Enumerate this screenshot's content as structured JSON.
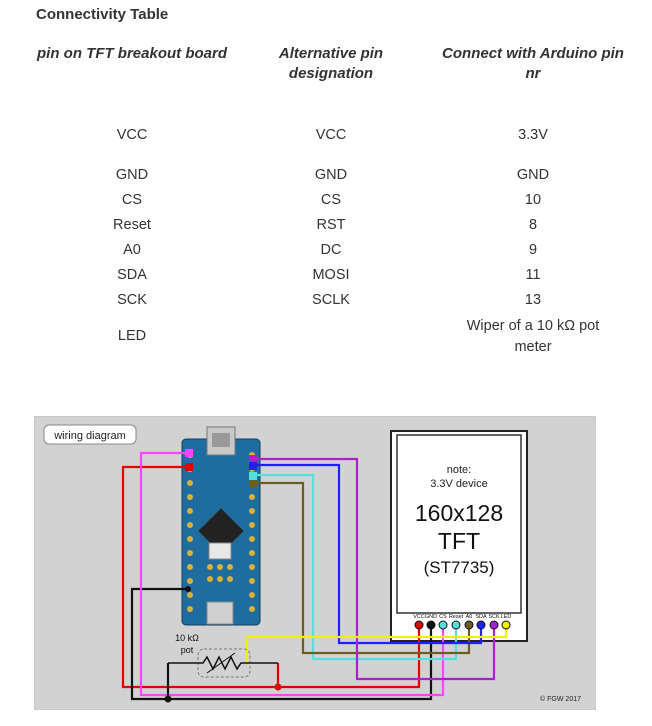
{
  "heading": "Connectivity Table",
  "table": {
    "columns": [
      "pin on TFT breakout board",
      "Alternative pin designation",
      "Connect with Arduino pin nr"
    ],
    "rows": [
      [
        "VCC",
        "VCC",
        "3.3V"
      ],
      [
        "GND",
        "GND",
        "GND"
      ],
      [
        "CS",
        "CS",
        "10"
      ],
      [
        "Reset",
        "RST",
        "8"
      ],
      [
        "A0",
        "DC",
        "9"
      ],
      [
        "SDA",
        "MOSI",
        "11"
      ],
      [
        "SCK",
        "SCLK",
        "13"
      ],
      [
        "LED",
        "",
        "Wiper of a 10 kΩ pot meter"
      ]
    ]
  },
  "diagram": {
    "label": "wiring diagram",
    "note_line1": "note:",
    "note_line2": "3.3V device",
    "resolution": "160x128",
    "type": "TFT",
    "driver": "(ST7735)",
    "pin_labels": [
      "VCC",
      "GND",
      "CS",
      "Reset",
      "A0",
      "SDA",
      "SCK",
      "LED"
    ],
    "pot_label_line1": "10 kΩ",
    "pot_label_line2": "pot",
    "copyright": "© FGW 2017",
    "wire_colors": {
      "vcc": "#e00000",
      "gnd": "#111111",
      "cs": "#ff44ff",
      "reset": "#55e0e0",
      "a0": "#6b5e1e",
      "sda": "#2020ff",
      "sck": "#aa22cc",
      "led": "#f0f000"
    }
  }
}
